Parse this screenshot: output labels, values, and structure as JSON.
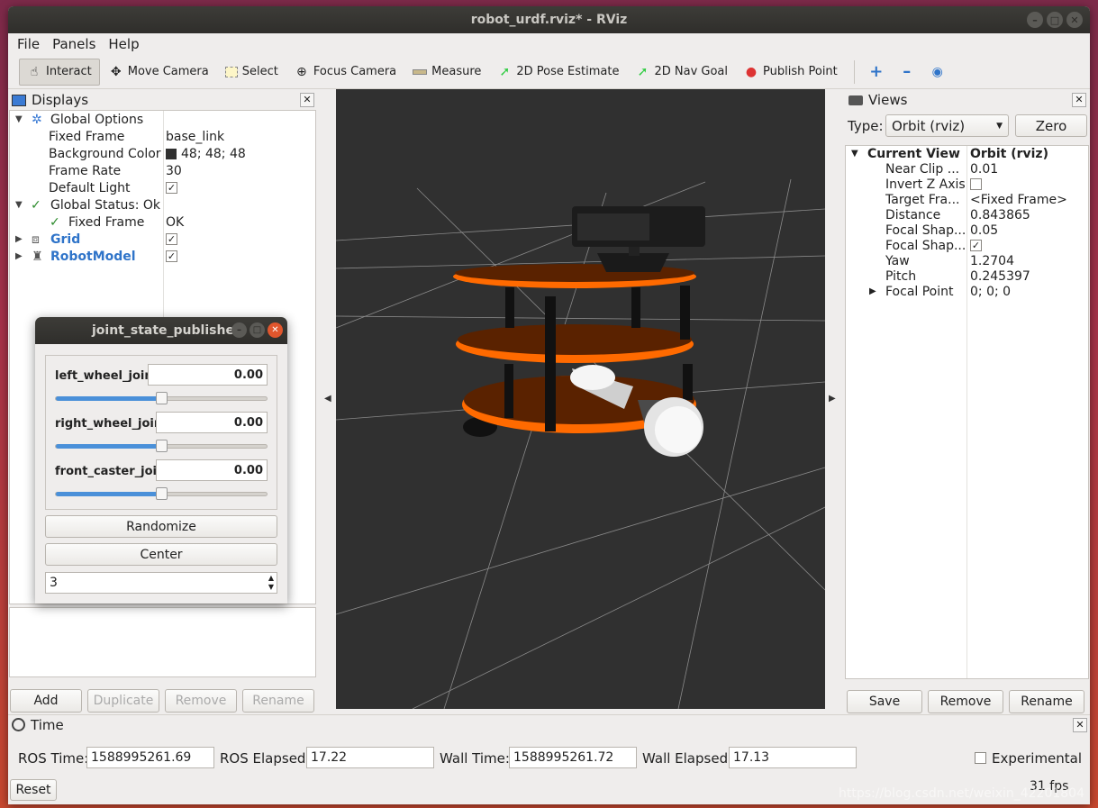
{
  "window": {
    "title": "robot_urdf.rviz* - RViz"
  },
  "menu": {
    "file": "File",
    "panels": "Panels",
    "help": "Help"
  },
  "toolbar": {
    "interact": "Interact",
    "move_camera": "Move Camera",
    "select": "Select",
    "focus_camera": "Focus Camera",
    "measure": "Measure",
    "pose_estimate": "2D Pose Estimate",
    "nav_goal": "2D Nav Goal",
    "publish_point": "Publish Point"
  },
  "displays": {
    "title": "Displays",
    "global_options": "Global Options",
    "fixed_frame_label": "Fixed Frame",
    "fixed_frame_value": "base_link",
    "bg_color_label": "Background Color",
    "bg_color_value": "48; 48; 48",
    "bg_color_hex": "#303030",
    "frame_rate_label": "Frame Rate",
    "frame_rate_value": "30",
    "default_light_label": "Default Light",
    "global_status": "Global Status: Ok",
    "status_fixed_frame": "Fixed Frame",
    "status_fixed_frame_value": "OK",
    "grid": "Grid",
    "robot_model": "RobotModel",
    "buttons": {
      "add": "Add",
      "duplicate": "Duplicate",
      "remove": "Remove",
      "rename": "Rename"
    }
  },
  "views": {
    "title": "Views",
    "type_label": "Type:",
    "type_value": "Orbit (rviz)",
    "zero": "Zero",
    "current_view": "Current View",
    "current_view_value": "Orbit (rviz)",
    "near_clip_label": "Near Clip ...",
    "near_clip_value": "0.01",
    "invert_z_label": "Invert Z Axis",
    "target_frame_label": "Target Fra...",
    "target_frame_value": "<Fixed Frame>",
    "distance_label": "Distance",
    "distance_value": "0.843865",
    "focal_shape_size_label": "Focal Shap...",
    "focal_shape_size_value": "0.05",
    "focal_shape_fixed_label": "Focal Shap...",
    "yaw_label": "Yaw",
    "yaw_value": "1.2704",
    "pitch_label": "Pitch",
    "pitch_value": "0.245397",
    "focal_point_label": "Focal Point",
    "focal_point_value": "0; 0; 0",
    "buttons": {
      "save": "Save",
      "remove": "Remove",
      "rename": "Rename"
    }
  },
  "jsp": {
    "title": "joint_state_publisher",
    "joints": [
      {
        "name": "left_wheel_joint",
        "value": "0.00",
        "level": 0.5
      },
      {
        "name": "right_wheel_joint",
        "value": "0.00",
        "level": 0.5
      },
      {
        "name": "front_caster_joint",
        "value": "0.00",
        "level": 0.5
      }
    ],
    "randomize": "Randomize",
    "center": "Center",
    "spin_value": "3"
  },
  "time": {
    "title": "Time",
    "ros_time_label": "ROS Time:",
    "ros_time_value": "1588995261.69",
    "ros_elapsed_label": "ROS Elapsed:",
    "ros_elapsed_value": "17.22",
    "wall_time_label": "Wall Time:",
    "wall_time_value": "1588995261.72",
    "wall_elapsed_label": "Wall Elapsed:",
    "wall_elapsed_value": "17.13",
    "experimental": "Experimental",
    "reset": "Reset",
    "fps": "31 fps"
  },
  "watermark": "https://blog.csdn.net/weixin_42201804",
  "colors": {
    "accent": "#2f74c9",
    "status_ok": "#2a8a2a",
    "robot_orange": "#ff6a00",
    "robot_plate": "#5a2200"
  }
}
